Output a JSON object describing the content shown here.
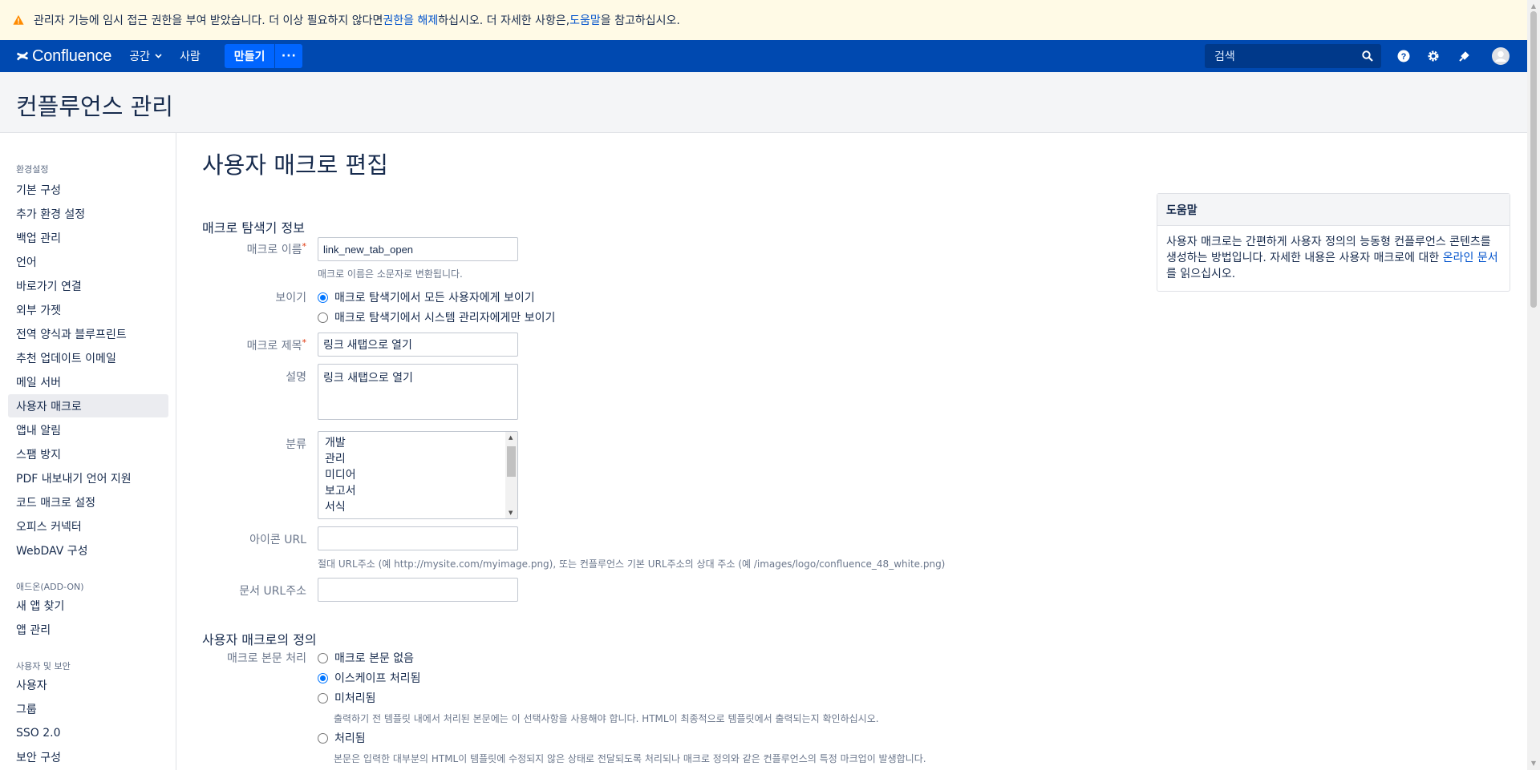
{
  "banner": {
    "text_before": "관리자 기능에 임시 접근 권한을 부여 받았습니다. 더 이상 필요하지 않다면 ",
    "link_revoke": "권한을 해제",
    "text_middle": "하십시오. 더 자세한 사항은, ",
    "link_help": "도움말",
    "text_after": "을 참고하십시오."
  },
  "topnav": {
    "logo_text": "Confluence",
    "spaces": "공간",
    "people": "사람",
    "create": "만들기",
    "more": "···",
    "search_placeholder": "검색"
  },
  "admin_title": "컨플루언스 관리",
  "sidebar": {
    "sections": [
      {
        "heading": "환경설정",
        "items": [
          "기본 구성",
          "추가 환경 설정",
          "백업 관리",
          "언어",
          "바로가기 연결",
          "외부 가젯",
          "전역 양식과 블루프린트",
          "추천 업데이트 이메일",
          "메일 서버",
          "사용자 매크로",
          "앱내 알림",
          "스팸 방지",
          "PDF 내보내기 언어 지원",
          "코드 매크로 설정",
          "오피스 커넥터",
          "WebDAV 구성"
        ]
      },
      {
        "heading": "애드온(ADD-ON)",
        "items": [
          "새 앱 찾기",
          "앱 관리"
        ]
      },
      {
        "heading": "사용자 및 보안",
        "items": [
          "사용자",
          "그룹",
          "SSO 2.0",
          "보안 구성"
        ]
      }
    ],
    "active_item": "사용자 매크로"
  },
  "page": {
    "title": "사용자 매크로 편집",
    "section1": "매크로 탐색기 정보",
    "macro_name_label": "매크로 이름",
    "macro_name_value": "link_new_tab_open",
    "macro_name_hint": "매크로 이름은 소문자로 변환됩니다.",
    "visibility_label": "보이기",
    "visibility_opt1": "매크로 탐색기에서 모든 사용자에게 보이기",
    "visibility_opt2": "매크로 탐색기에서 시스템 관리자에게만 보이기",
    "macro_title_label": "매크로 제목",
    "macro_title_value": "링크 새탭으로 열기",
    "desc_label": "설명",
    "desc_value": "링크 새탭으로 열기",
    "category_label": "분류",
    "categories": [
      "개발",
      "관리",
      "미디어",
      "보고서",
      "서식"
    ],
    "icon_url_label": "아이콘 URL",
    "icon_url_value": "",
    "icon_url_hint": "절대 URL주소 (예 http://mysite.com/myimage.png), 또는 컨플루언스 기본 URL주소의 상대 주소 (예 /images/logo/confluence_48_white.png)",
    "doc_url_label": "문서 URL주소",
    "doc_url_value": "",
    "section2": "사용자 매크로의 정의",
    "body_label": "매크로 본문 처리",
    "body_opt1": "매크로 본문 없음",
    "body_opt2": "이스케이프 처리됨",
    "body_opt3": "미처리됨",
    "body_opt3_hint": "출력하기 전 템플릿 내에서 처리된 본문에는 이 선택사항을 사용해야 합니다. HTML이 최종적으로 템플릿에서 출력되는지 확인하십시오.",
    "body_opt4": "처리됨",
    "body_opt4_hint": "본문은 입력한 대부분의 HTML이 템플릿에 수정되지 않은 상태로 전달되도록 처리되나 매크로 정의와 같은 컨플루언스의 특정 마크업이 발생합니다."
  },
  "help": {
    "title": "도움말",
    "text_before": "사용자 매크로는 간편하게 사용자 정의의 능동형 컨플루언스 콘텐츠를 생성하는 방법입니다. 자세한 내용은 사용자 매크로에 대한 ",
    "link": "온라인 문서",
    "text_after": "를 읽으십시오."
  },
  "colors": {
    "nav_bg": "#0049b0",
    "banner_bg": "#fffae6",
    "create_btn": "#0065ff",
    "link": "#0052cc"
  }
}
